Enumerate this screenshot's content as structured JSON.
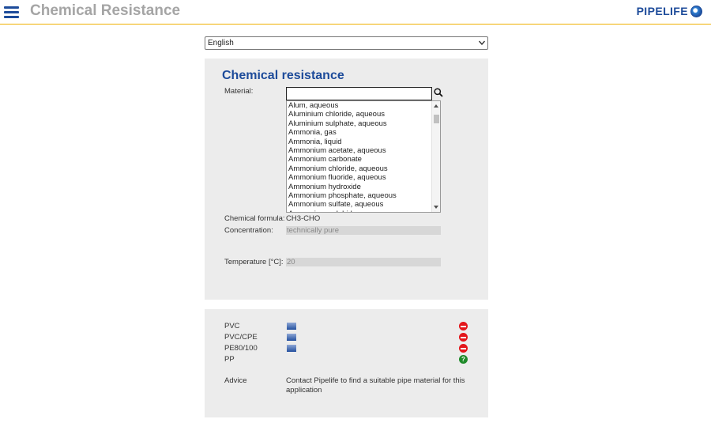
{
  "header": {
    "title": "Chemical Resistance",
    "logo_text": "PIPELIFE"
  },
  "language": {
    "selected": "English"
  },
  "form": {
    "heading": "Chemical resistance",
    "material_label": "Material:",
    "material_value": "",
    "material_options": [
      "Alum, aqueous",
      "Aluminium chloride, aqueous",
      "Aluminium sulphate, aqueous",
      "Ammonia, gas",
      "Ammonia, liquid",
      "Ammonium acetate, aqueous",
      "Ammonium carbonate",
      "Ammonium chloride, aqueous",
      "Ammonium fluoride, aqueous",
      "Ammonium hydroxide",
      "Ammonium phosphate, aqueous",
      "Ammonium sulfate, aqueous",
      "Ammonium sulphide"
    ],
    "formula_label": "Chemical formula:",
    "formula_value": "CH3-CHO",
    "concentration_label": "Concentration:",
    "concentration_value": "technically pure",
    "temperature_label": "Temperature [°C]:",
    "temperature_value": "20"
  },
  "results": {
    "rows": [
      {
        "name": "PVC",
        "status": "not-resistant"
      },
      {
        "name": "PVC/CPE",
        "status": "not-resistant"
      },
      {
        "name": "PE80/100",
        "status": "not-resistant"
      },
      {
        "name": "PP",
        "status": "unknown",
        "status_symbol": "?"
      }
    ],
    "advice_label": "Advice",
    "advice_text": "Contact Pipelife to find a suitable pipe material for this application"
  },
  "colors": {
    "brand_blue": "#1d4b9a",
    "header_rule": "#f0b000",
    "status_red": "#e3161b",
    "status_green": "#1f8b2a",
    "panel_bg": "#ececec"
  }
}
